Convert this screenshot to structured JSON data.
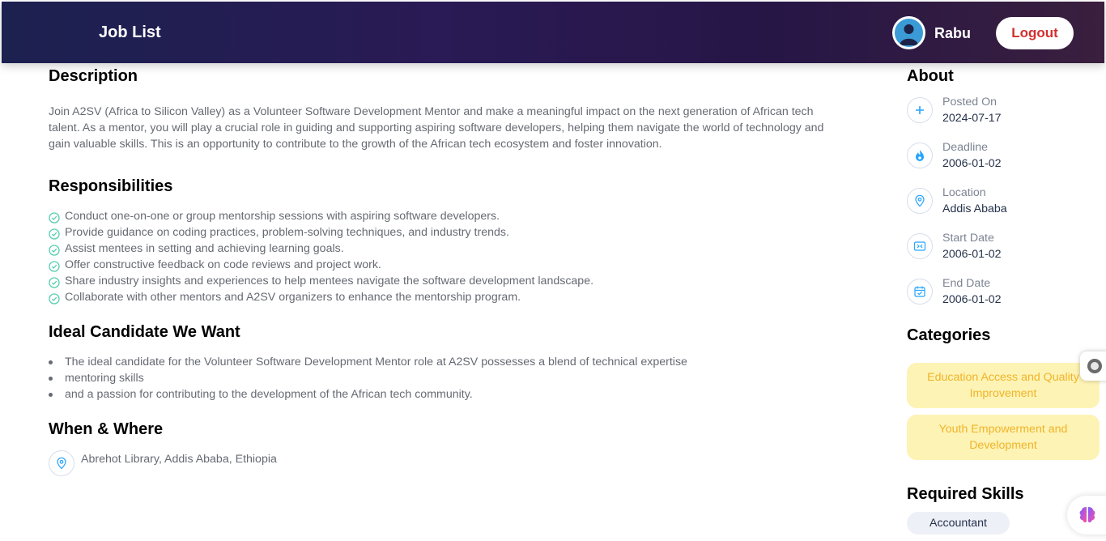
{
  "header": {
    "title": "Job List",
    "username": "Rabu",
    "logout_label": "Logout"
  },
  "description": {
    "heading": "Description",
    "text": "Join A2SV (Africa to Silicon Valley) as a Volunteer Software Development Mentor and make a meaningful impact on the next generation of African tech talent. As a mentor, you will play a crucial role in guiding and supporting aspiring software developers, helping them navigate the world of technology and gain valuable skills. This is an opportunity to contribute to the growth of the African tech ecosystem and foster innovation."
  },
  "responsibilities": {
    "heading": "Responsibilities",
    "items": [
      "Conduct one-on-one or group mentorship sessions with aspiring software developers.",
      "Provide guidance on coding practices, problem-solving techniques, and industry trends.",
      "Assist mentees in setting and achieving learning goals.",
      "Offer constructive feedback on code reviews and project work.",
      "Share industry insights and experiences to help mentees navigate the software development landscape.",
      "Collaborate with other mentors and A2SV organizers to enhance the mentorship program."
    ]
  },
  "ideal_candidate": {
    "heading": "Ideal Candidate We Want",
    "items": [
      "The ideal candidate for the Volunteer Software Development Mentor role at A2SV possesses a blend of technical expertise",
      "mentoring skills",
      "and a passion for contributing to the development of the African tech community."
    ]
  },
  "when_where": {
    "heading": "When & Where",
    "location": "Abrehot Library, Addis Ababa, Ethiopia"
  },
  "about": {
    "heading": "About",
    "items": [
      {
        "label": "Posted On",
        "value": "2024-07-17",
        "icon": "plus-circle-icon"
      },
      {
        "label": "Deadline",
        "value": "2006-01-02",
        "icon": "fire-icon"
      },
      {
        "label": "Location",
        "value": "Addis Ababa",
        "icon": "location-pin-icon"
      },
      {
        "label": "Start Date",
        "value": "2006-01-02",
        "icon": "start-date-icon"
      },
      {
        "label": "End Date",
        "value": "2006-01-02",
        "icon": "calendar-check-icon"
      }
    ]
  },
  "categories": {
    "heading": "Categories",
    "items": [
      "Education Access and Quality Improvement",
      "Youth Empowerment and Development"
    ]
  },
  "skills": {
    "heading": "Required Skills",
    "items": [
      "Accountant"
    ]
  },
  "colors": {
    "accent": "#26a4ff",
    "success": "#56cdad",
    "category_bg": "#fdf3b5",
    "category_text": "#f0b429",
    "logout_text": "#d32f2f"
  }
}
